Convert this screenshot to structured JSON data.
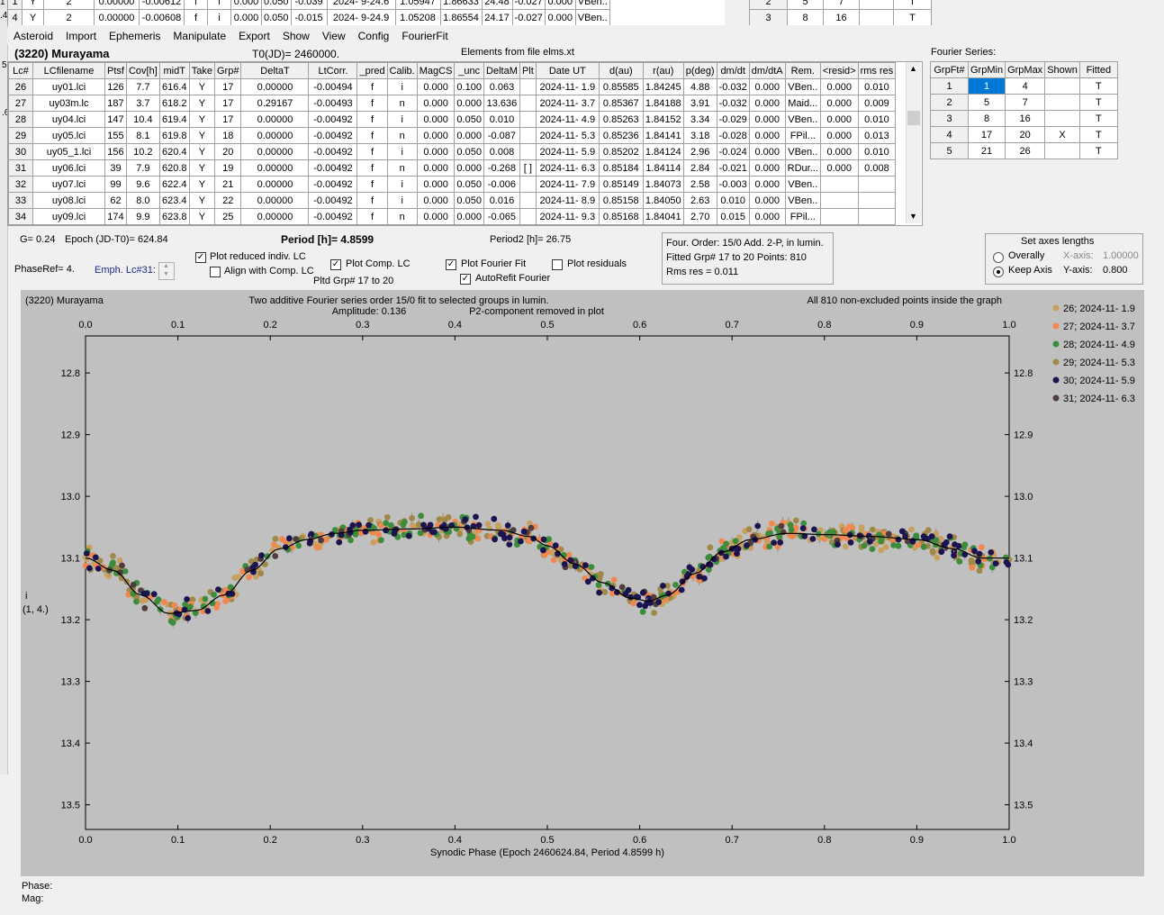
{
  "top_grid_rows": [
    [
      "1",
      "Y",
      "2",
      "0.00000",
      "-0.00612",
      "f",
      "i",
      "0.000",
      "0.050",
      "-0.039",
      "2024- 9-24.6",
      "1.05947",
      "1.86633",
      "24.48",
      "-0.027",
      "0.000",
      "VBen.."
    ],
    [
      "4",
      "Y",
      "2",
      "0.00000",
      "-0.00608",
      "f",
      "i",
      "0.000",
      "0.050",
      "-0.015",
      "2024- 9-24.9",
      "1.05208",
      "1.86554",
      "24.17",
      "-0.027",
      "0.000",
      "VBen.."
    ]
  ],
  "top_right_rows": [
    [
      "2",
      "5",
      "7",
      "",
      "T"
    ],
    [
      "3",
      "8",
      "16",
      "",
      "T"
    ]
  ],
  "left_edge_marks": [
    "1",
    ".4",
    "5",
    ".6"
  ],
  "menu": [
    "Asteroid",
    "Import",
    "Ephemeris",
    "Manipulate",
    "Export",
    "Show",
    "View",
    "Config",
    "FourierFit"
  ],
  "header": {
    "asteroid": "(3220) Murayama",
    "t0": "T0(JD)= 2460000.",
    "elements_file": "Elements from file elms.xt",
    "fourier_label": "Fourier Series:"
  },
  "lc_columns": [
    "Lc#",
    "LCfilename",
    "Ptsf",
    "Cov[h]",
    "midT",
    "Take",
    "Grp#",
    "DeltaT",
    "LtCorr.",
    "_pred",
    "Calib.",
    "MagCS",
    "_unc",
    "DeltaM",
    "Plt",
    "Date UT",
    "d(au)",
    "r(au)",
    "p(deg)",
    "dm/dt",
    "dm/dtA",
    "Rem.",
    "<resid>",
    "rms res"
  ],
  "lc_rows": [
    [
      "26",
      "uy01.lci",
      "126",
      "7.7",
      "616.4",
      "Y",
      "17",
      "0.00000",
      "-0.00494",
      "f",
      "i",
      "0.000",
      "0.100",
      "0.063",
      "",
      "2024-11- 1.9",
      "0.85585",
      "1.84245",
      "4.88",
      "-0.032",
      "0.000",
      "VBen..",
      "0.000",
      "0.010"
    ],
    [
      "27",
      "uy03m.lc",
      "187",
      "3.7",
      "618.2",
      "Y",
      "17",
      "0.29167",
      "-0.00493",
      "f",
      "n",
      "0.000",
      "0.000",
      "13.636",
      "",
      "2024-11- 3.7",
      "0.85367",
      "1.84188",
      "3.91",
      "-0.032",
      "0.000",
      "Maid...",
      "0.000",
      "0.009"
    ],
    [
      "28",
      "uy04.lci",
      "147",
      "10.4",
      "619.4",
      "Y",
      "17",
      "0.00000",
      "-0.00492",
      "f",
      "i",
      "0.000",
      "0.050",
      "0.010",
      "",
      "2024-11- 4.9",
      "0.85263",
      "1.84152",
      "3.34",
      "-0.029",
      "0.000",
      "VBen..",
      "0.000",
      "0.010"
    ],
    [
      "29",
      "uy05.lci",
      "155",
      "8.1",
      "619.8",
      "Y",
      "18",
      "0.00000",
      "-0.00492",
      "f",
      "n",
      "0.000",
      "0.000",
      "-0.087",
      "",
      "2024-11- 5.3",
      "0.85236",
      "1.84141",
      "3.18",
      "-0.028",
      "0.000",
      "FPil...",
      "0.000",
      "0.013"
    ],
    [
      "30",
      "uy05_1.lci",
      "156",
      "10.2",
      "620.4",
      "Y",
      "20",
      "0.00000",
      "-0.00492",
      "f",
      "i",
      "0.000",
      "0.050",
      "0.008",
      "",
      "2024-11- 5.9",
      "0.85202",
      "1.84124",
      "2.96",
      "-0.024",
      "0.000",
      "VBen..",
      "0.000",
      "0.010"
    ],
    [
      "31",
      "uy06.lci",
      "39",
      "7.9",
      "620.8",
      "Y",
      "19",
      "0.00000",
      "-0.00492",
      "f",
      "n",
      "0.000",
      "0.000",
      "-0.268",
      "[ ]",
      "2024-11- 6.3",
      "0.85184",
      "1.84114",
      "2.84",
      "-0.021",
      "0.000",
      "RDur...",
      "0.000",
      "0.008"
    ],
    [
      "32",
      "uy07.lci",
      "99",
      "9.6",
      "622.4",
      "Y",
      "21",
      "0.00000",
      "-0.00492",
      "f",
      "i",
      "0.000",
      "0.050",
      "-0.006",
      "",
      "2024-11- 7.9",
      "0.85149",
      "1.84073",
      "2.58",
      "-0.003",
      "0.000",
      "VBen..",
      "",
      ""
    ],
    [
      "33",
      "uy08.lci",
      "62",
      "8.0",
      "623.4",
      "Y",
      "22",
      "0.00000",
      "-0.00492",
      "f",
      "i",
      "0.000",
      "0.050",
      "0.016",
      "",
      "2024-11- 8.9",
      "0.85158",
      "1.84050",
      "2.63",
      "0.010",
      "0.000",
      "VBen..",
      "",
      ""
    ],
    [
      "34",
      "uy09.lci",
      "174",
      "9.9",
      "623.8",
      "Y",
      "25",
      "0.00000",
      "-0.00492",
      "f",
      "n",
      "0.000",
      "0.000",
      "-0.065",
      "",
      "2024-11- 9.3",
      "0.85168",
      "1.84041",
      "2.70",
      "0.015",
      "0.000",
      "FPil...",
      "",
      ""
    ]
  ],
  "fourier_columns": [
    "GrpFt#",
    "GrpMin",
    "GrpMax",
    "Shown",
    "Fitted"
  ],
  "fourier_rows": [
    [
      "1",
      "1",
      "4",
      "",
      "T"
    ],
    [
      "2",
      "5",
      "7",
      "",
      "T"
    ],
    [
      "3",
      "8",
      "16",
      "",
      "T"
    ],
    [
      "4",
      "17",
      "20",
      "X",
      "T"
    ],
    [
      "5",
      "21",
      "26",
      "",
      "T"
    ]
  ],
  "controls": {
    "g": "G= 0.24",
    "epoch": "Epoch (JD-T0)= 624.84",
    "period": "Period [h]= 4.8599",
    "period2": "Period2 [h]= 26.75",
    "phaseref": "PhaseRef= 4.",
    "emph": "Emph. Lc#31:",
    "cb_reduced": "Plot reduced indiv. LC",
    "cb_align": "Align with Comp. LC",
    "cb_comp": "Plot Comp. LC",
    "pltd_grp": "Pltd Grp#  17 to   20",
    "cb_fourier": "Plot Fourier Fit",
    "cb_autorefit": "AutoRefit Fourier",
    "cb_residuals": "Plot residuals",
    "info1": "Four. Order: 15/0     Add. 2-P, in lumin.",
    "info2": "Fitted Grp# 17 to 20 Points: 810",
    "info3": "Rms res       = 0.011",
    "axes_title": "Set axes lengths",
    "overally": "Overally",
    "keep_axis": "Keep Axis",
    "xaxis_label": "X-axis:",
    "xaxis_val": "1.00000",
    "yaxis_label": "Y-axis:",
    "yaxis_val": "0.800"
  },
  "footer": {
    "phase": "Phase:",
    "mag": "Mag:"
  },
  "chart_data": {
    "type": "scatter",
    "title": "(3220) Murayama",
    "subtitle_line1": "Two additive Fourier series order 15/0 fit to selected groups in lumin.",
    "subtitle_line2": "Amplitude: 0.136",
    "subtitle_line3": "P2-component removed in plot",
    "note": "All 810 non-excluded points inside the graph",
    "xlabel": "Synodic Phase (Epoch 2460624.84, Period 4.8599 h)",
    "ylabel": "i",
    "ylabel2": "(1, 4.)",
    "xlim": [
      0,
      1
    ],
    "ylim": [
      12.74,
      13.54
    ],
    "y_inverted": true,
    "xticks": [
      "0.0",
      "0.1",
      "0.2",
      "0.3",
      "0.4",
      "0.5",
      "0.6",
      "0.7",
      "0.8",
      "0.9",
      "1.0"
    ],
    "yticks": [
      "12.8",
      "12.9",
      "13.0",
      "13.1",
      "13.2",
      "13.3",
      "13.4",
      "13.5"
    ],
    "fit_curve": [
      [
        0.0,
        13.1
      ],
      [
        0.03,
        13.12
      ],
      [
        0.06,
        13.16
      ],
      [
        0.09,
        13.19
      ],
      [
        0.12,
        13.185
      ],
      [
        0.15,
        13.16
      ],
      [
        0.18,
        13.12
      ],
      [
        0.21,
        13.085
      ],
      [
        0.24,
        13.07
      ],
      [
        0.27,
        13.06
      ],
      [
        0.3,
        13.055
      ],
      [
        0.35,
        13.053
      ],
      [
        0.4,
        13.05
      ],
      [
        0.45,
        13.055
      ],
      [
        0.48,
        13.065
      ],
      [
        0.5,
        13.08
      ],
      [
        0.53,
        13.11
      ],
      [
        0.56,
        13.14
      ],
      [
        0.59,
        13.165
      ],
      [
        0.61,
        13.17
      ],
      [
        0.63,
        13.16
      ],
      [
        0.66,
        13.125
      ],
      [
        0.69,
        13.09
      ],
      [
        0.72,
        13.07
      ],
      [
        0.76,
        13.06
      ],
      [
        0.8,
        13.062
      ],
      [
        0.85,
        13.065
      ],
      [
        0.9,
        13.07
      ],
      [
        0.94,
        13.085
      ],
      [
        0.97,
        13.1
      ],
      [
        1.0,
        13.1
      ]
    ],
    "series": [
      {
        "name": "26; 2024-11- 1.9",
        "color": "#c8a060"
      },
      {
        "name": "27; 2024-11- 3.7",
        "color": "#f08850"
      },
      {
        "name": "28; 2024-11- 4.9",
        "color": "#3c8c3c"
      },
      {
        "name": "29; 2024-11- 5.3",
        "color": "#a08848"
      },
      {
        "name": "30; 2024-11- 5.9",
        "color": "#1c1450"
      },
      {
        "name": "31; 2024-11- 6.3",
        "color": "#503c3c"
      }
    ]
  }
}
